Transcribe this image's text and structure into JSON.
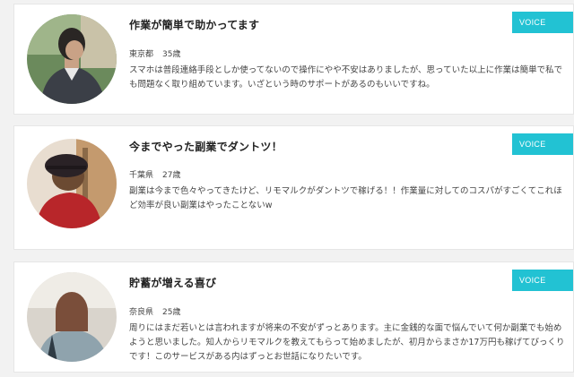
{
  "testimonials": [
    {
      "title": "作業が簡単で助かってます",
      "location": "東京都",
      "age": "35歳",
      "body": "スマホは普段連絡手段としか使ってないので操作にやや不安はありましたが、思っていた以上に作業は簡単で私でも問題なく取り組めています。いざという時のサポートがあるのもいいですね。",
      "badge": "VOICE"
    },
    {
      "title": "今までやった副業でダントツ！",
      "location": "千葉県",
      "age": "27歳",
      "body": "副業は今まで色々やってきたけど、リモマルクがダントツで稼げる！！作業量に対してのコスパがすごくてこれほど効率が良い副業はやったことないw",
      "badge": "VOICE"
    },
    {
      "title": "貯蓄が増える喜び",
      "location": "奈良県",
      "age": "25歳",
      "body": "周りにはまだ若いとは言われますが将来の不安がずっとあります。主に金銭的な面で悩んでいて何か副業でも始めようと思いました。知人からリモマルクを教えてもらって始めましたが、初月からまさか17万円も稼げてびっくりです！このサービスがある内はずっとお世話になりたいです。",
      "badge": "VOICE"
    }
  ],
  "colors": {
    "badge": "#22c2d3",
    "page_bg": "#f2f2f2",
    "card_bg": "#ffffff"
  }
}
